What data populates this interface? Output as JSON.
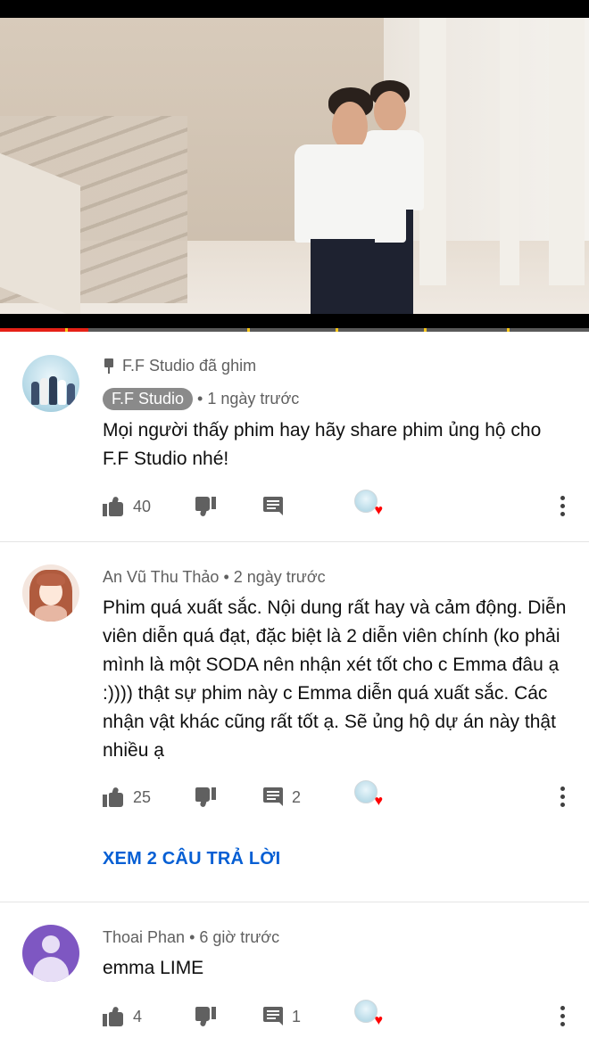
{
  "video": {
    "progress_fraction": 0.15,
    "chapter_markers": [
      0.11,
      0.42,
      0.57,
      0.72,
      0.86
    ]
  },
  "colors": {
    "progress": "#e62117",
    "chapter_marker": "#f7c61a",
    "link": "#065fd4",
    "heart": "#ff0000"
  },
  "comments": [
    {
      "pinned_label": "F.F Studio đã ghim",
      "author": "F.F Studio",
      "is_creator": true,
      "time": "1 ngày trước",
      "text": "Mọi người thấy phim hay hãy share phim ủng hộ cho F.F Studio nhé!",
      "likes": "40",
      "replies": "",
      "avatar_icon": "channel-avatar-icon"
    },
    {
      "author": "An Vũ Thu Thảo",
      "time": "2 ngày trước",
      "text": "Phim quá xuất sắc. Nội dung rất hay và cảm động. Diễn viên diễn quá đạt, đặc biệt là 2 diễn viên chính (ko phải mình là một SODA nên nhận xét tốt cho c Emma đâu ạ :)))) thật sự phim này c Emma diễn quá xuất sắc. Các nhận vật khác cũng rất tốt ạ. Sẽ ủng hộ dự án này thật nhiều ạ",
      "likes": "25",
      "replies": "2",
      "view_replies": "XEM 2 CÂU TRẢ LỜI",
      "avatar_icon": "user-avatar-icon"
    },
    {
      "author": "Thoai Phan",
      "time": "6 giờ trước",
      "text": "emma LIME",
      "likes": "4",
      "replies": "1",
      "avatar_icon": "default-avatar-icon"
    }
  ],
  "separator": "•",
  "heart_glyph": "♥"
}
